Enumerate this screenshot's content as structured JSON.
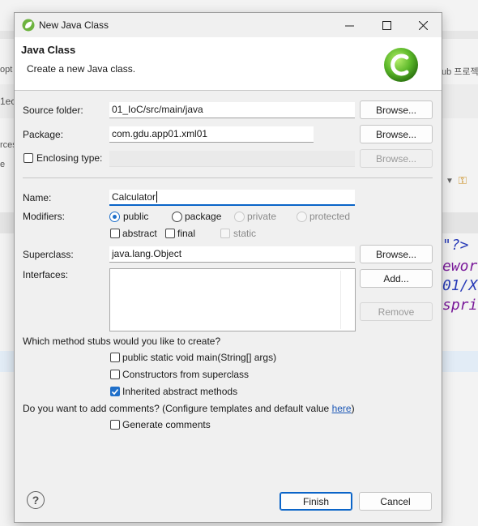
{
  "background": {
    "left_snippets": [
      "opt",
      "1ec",
      "rces",
      "e"
    ],
    "right_snippet": "ub 프로젝",
    "code_lines": [
      "\"?>",
      "ewor",
      "01/X",
      "spri"
    ]
  },
  "window": {
    "title": "New Java Class",
    "minimize_icon": "minimize-icon",
    "maximize_icon": "maximize-icon",
    "close_icon": "close-icon"
  },
  "banner": {
    "title": "Java Class",
    "subtitle": "Create a new Java class."
  },
  "form": {
    "source_folder": {
      "label": "Source folder:",
      "value": "01_IoC/src/main/java",
      "browse": "Browse..."
    },
    "package": {
      "label": "Package:",
      "value": "com.gdu.app01.xml01",
      "browse": "Browse..."
    },
    "enclosing_type": {
      "label": "Enclosing type:",
      "value": "",
      "browse": "Browse..."
    },
    "name": {
      "label": "Name:",
      "value": "Calculator"
    },
    "modifiers": {
      "label": "Modifiers:",
      "public": "public",
      "package": "package",
      "private": "private",
      "protected": "protected",
      "abstract": "abstract",
      "final": "final",
      "static": "static"
    },
    "superclass": {
      "label": "Superclass:",
      "value": "java.lang.Object",
      "browse": "Browse..."
    },
    "interfaces": {
      "label": "Interfaces:",
      "add": "Add...",
      "remove": "Remove"
    },
    "stubs": {
      "question": "Which method stubs would you like to create?",
      "main": "public static void main(String[] args)",
      "constructors": "Constructors from superclass",
      "inherited": "Inherited abstract methods"
    },
    "comments": {
      "question": "Do you want to add comments? (Configure templates and default value ",
      "link": "here",
      "close_paren": ")",
      "generate": "Generate comments"
    }
  },
  "footer": {
    "help": "?",
    "finish": "Finish",
    "cancel": "Cancel"
  },
  "colors": {
    "accent": "#1f6fc9",
    "focus": "#0a64c8",
    "logo": "#5cb82a"
  }
}
